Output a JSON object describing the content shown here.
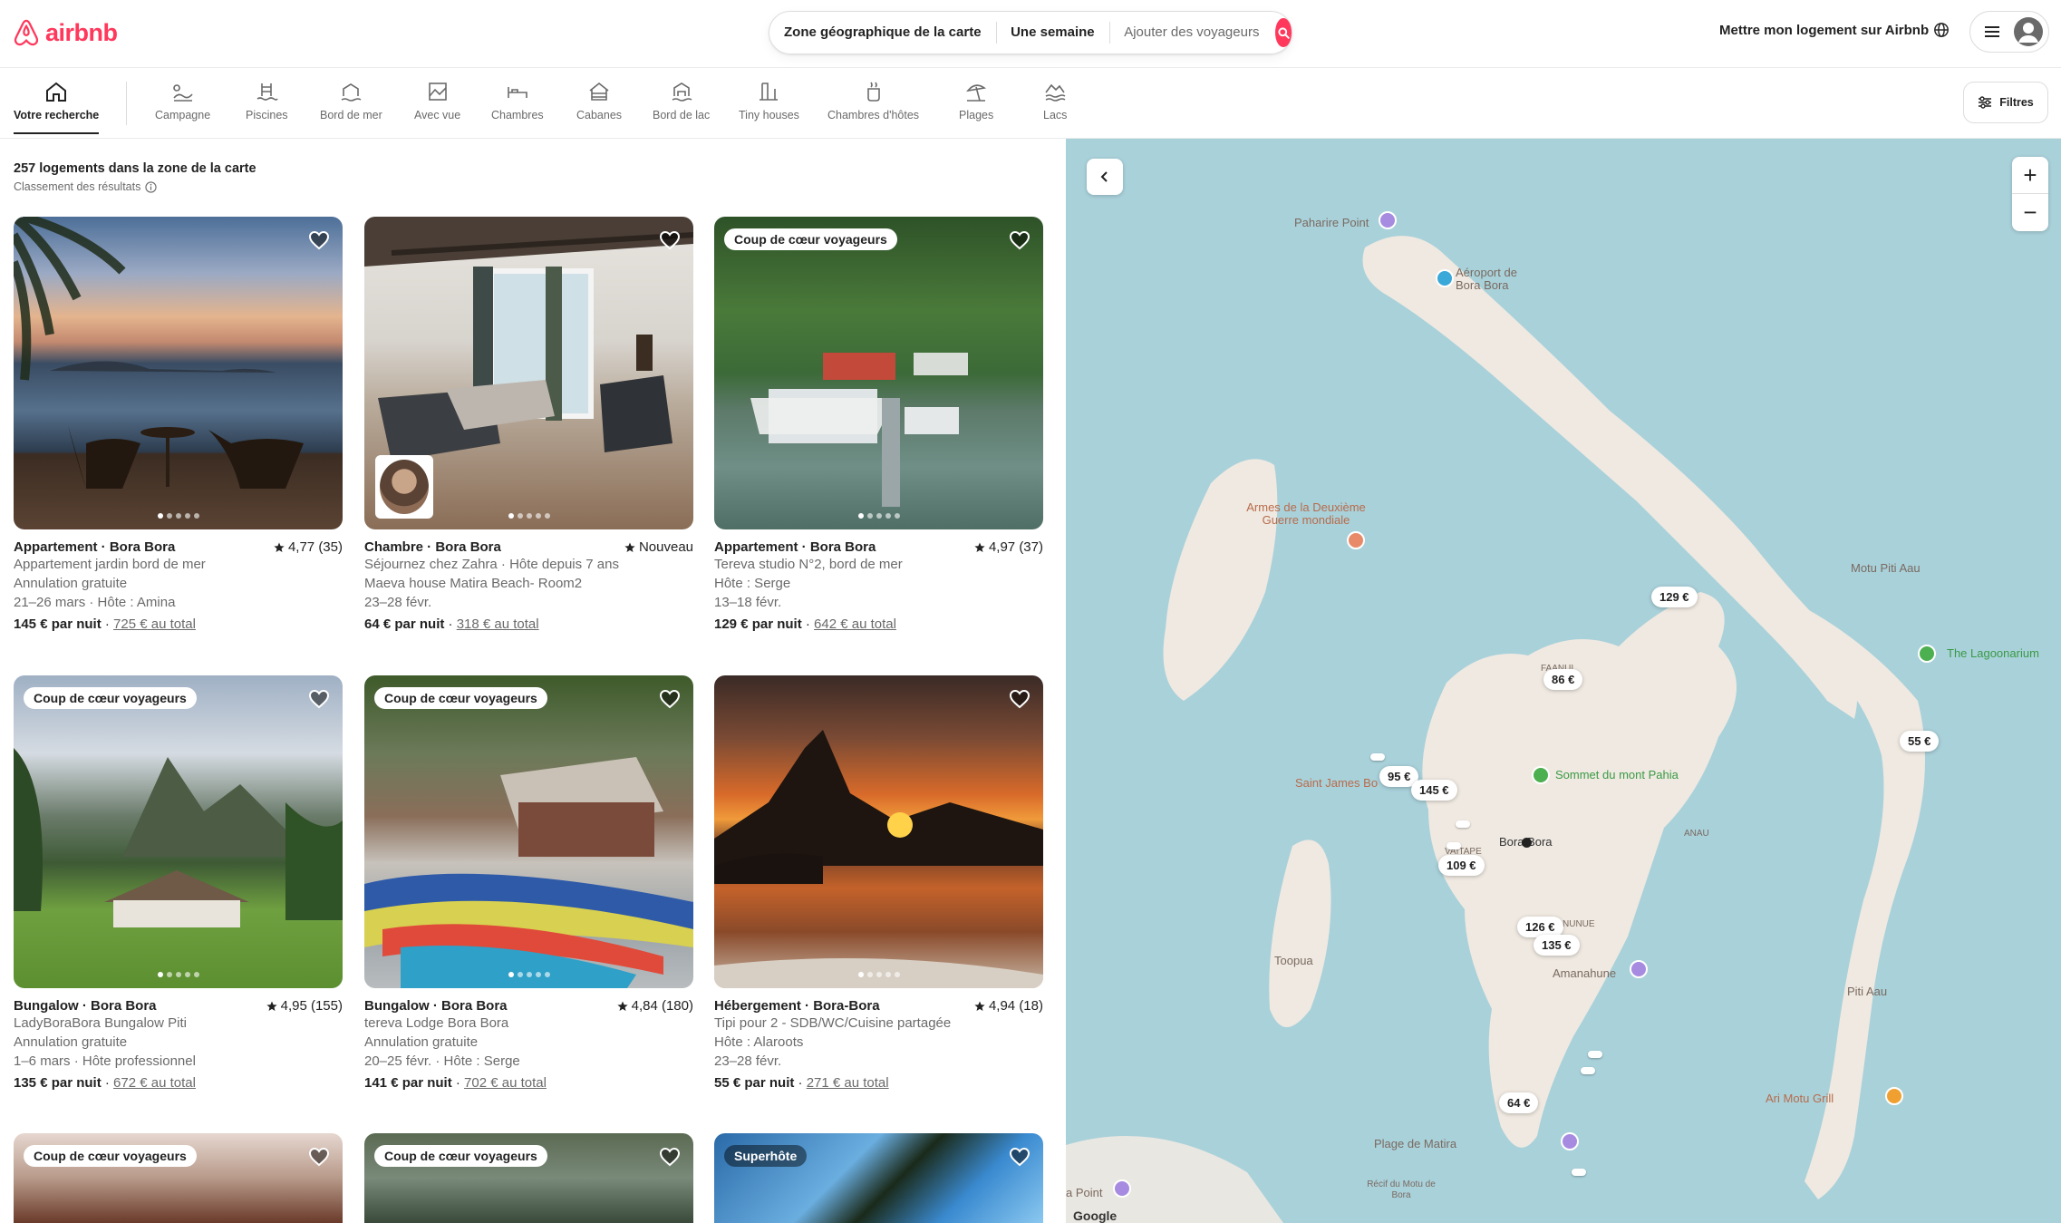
{
  "header": {
    "brand": "airbnb",
    "search": {
      "location": "Zone géographique de la carte",
      "dates": "Une semaine",
      "guests": "Ajouter des voyageurs"
    },
    "host_link": "Mettre mon logement sur Airbnb"
  },
  "categories": [
    {
      "label": "Votre recherche",
      "icon": "home-icon"
    },
    {
      "label": "Campagne",
      "icon": "countryside-icon"
    },
    {
      "label": "Piscines",
      "icon": "pool-icon"
    },
    {
      "label": "Bord de mer",
      "icon": "beachfront-icon"
    },
    {
      "label": "Avec vue",
      "icon": "view-icon"
    },
    {
      "label": "Chambres",
      "icon": "rooms-icon"
    },
    {
      "label": "Cabanes",
      "icon": "cabin-icon"
    },
    {
      "label": "Bord de lac",
      "icon": "lakefront-icon"
    },
    {
      "label": "Tiny houses",
      "icon": "tiny-house-icon"
    },
    {
      "label": "Chambres d'hôtes",
      "icon": "bed-breakfast-icon"
    },
    {
      "label": "Plages",
      "icon": "beach-icon"
    },
    {
      "label": "Lacs",
      "icon": "lake-icon"
    }
  ],
  "filters_label": "Filtres",
  "results": {
    "title": "257 logements dans la zone de la carte",
    "subtitle": "Classement des résultats"
  },
  "listings": [
    {
      "badge": "",
      "title": "Appartement · Bora Bora",
      "rating": "4,77 (35)",
      "line1": "Appartement jardin bord de mer",
      "line2": "Annulation gratuite",
      "line3": "21–26 mars · Hôte : Amina",
      "price": "145 € par nuit",
      "total": "725 € au total"
    },
    {
      "badge": "",
      "title": "Chambre · Bora Bora",
      "rating": "Nouveau",
      "line1": "Séjournez chez Zahra · Hôte depuis 7 ans",
      "line2": "Maeva house Matira Beach- Room2",
      "line3": "23–28 févr.",
      "price": "64 € par nuit",
      "total": "318 € au total"
    },
    {
      "badge": "Coup de cœur voyageurs",
      "title": "Appartement · Bora Bora",
      "rating": "4,97 (37)",
      "line1": "Tereva studio N°2, bord de mer",
      "line2": "Hôte : Serge",
      "line3": "13–18 févr.",
      "price": "129 € par nuit",
      "total": "642 € au total"
    },
    {
      "badge": "Coup de cœur voyageurs",
      "title": "Bungalow · Bora Bora",
      "rating": "4,95 (155)",
      "line1": "LadyBoraBora Bungalow Piti",
      "line2": "Annulation gratuite",
      "line3": "1–6 mars · Hôte professionnel",
      "price": "135 € par nuit",
      "total": "672 € au total"
    },
    {
      "badge": "Coup de cœur voyageurs",
      "title": "Bungalow · Bora Bora",
      "rating": "4,84 (180)",
      "line1": "tereva Lodge Bora Bora",
      "line2": "Annulation gratuite",
      "line3": "20–25 févr. · Hôte : Serge",
      "price": "141 € par nuit",
      "total": "702 € au total"
    },
    {
      "badge": "",
      "title": "Hébergement · Bora-Bora",
      "rating": "4,94 (18)",
      "line1": "Tipi pour 2 - SDB/WC/Cuisine partagée",
      "line2": "Hôte : Alaroots",
      "line3": "23–28 févr.",
      "price": "55 € par nuit",
      "total": "271 € au total"
    },
    {
      "badge": "Coup de cœur voyageurs"
    },
    {
      "badge": "Coup de cœur voyageurs"
    },
    {
      "badge": "Superhôte"
    }
  ],
  "map": {
    "price_pins": [
      "129 €",
      "86 €",
      "95 €",
      "145 €",
      "109 €",
      "126 €",
      "135 €",
      "64 €",
      "55 €"
    ],
    "labels": [
      "Paharire Point",
      "Aéroport de Bora Bora",
      "Armes de la Deuxième Guerre mondiale",
      "Motu Piti Aau",
      "The Lagoonarium",
      "FAANUI",
      "Saint James Bo",
      "Sommet du mont Pahia",
      "Bora Bora",
      "ANAU",
      "VAITAPE",
      "NUNUE",
      "Amanahune",
      "Toopua",
      "Piti Aau",
      "Ari Motu Grill",
      "Plage de Matira",
      "Récif du Motu de Bora",
      "a Point",
      "Google"
    ],
    "colors": {
      "water": "#a9d1da",
      "land": "#efe9e1",
      "accent": "#FF385C"
    }
  }
}
